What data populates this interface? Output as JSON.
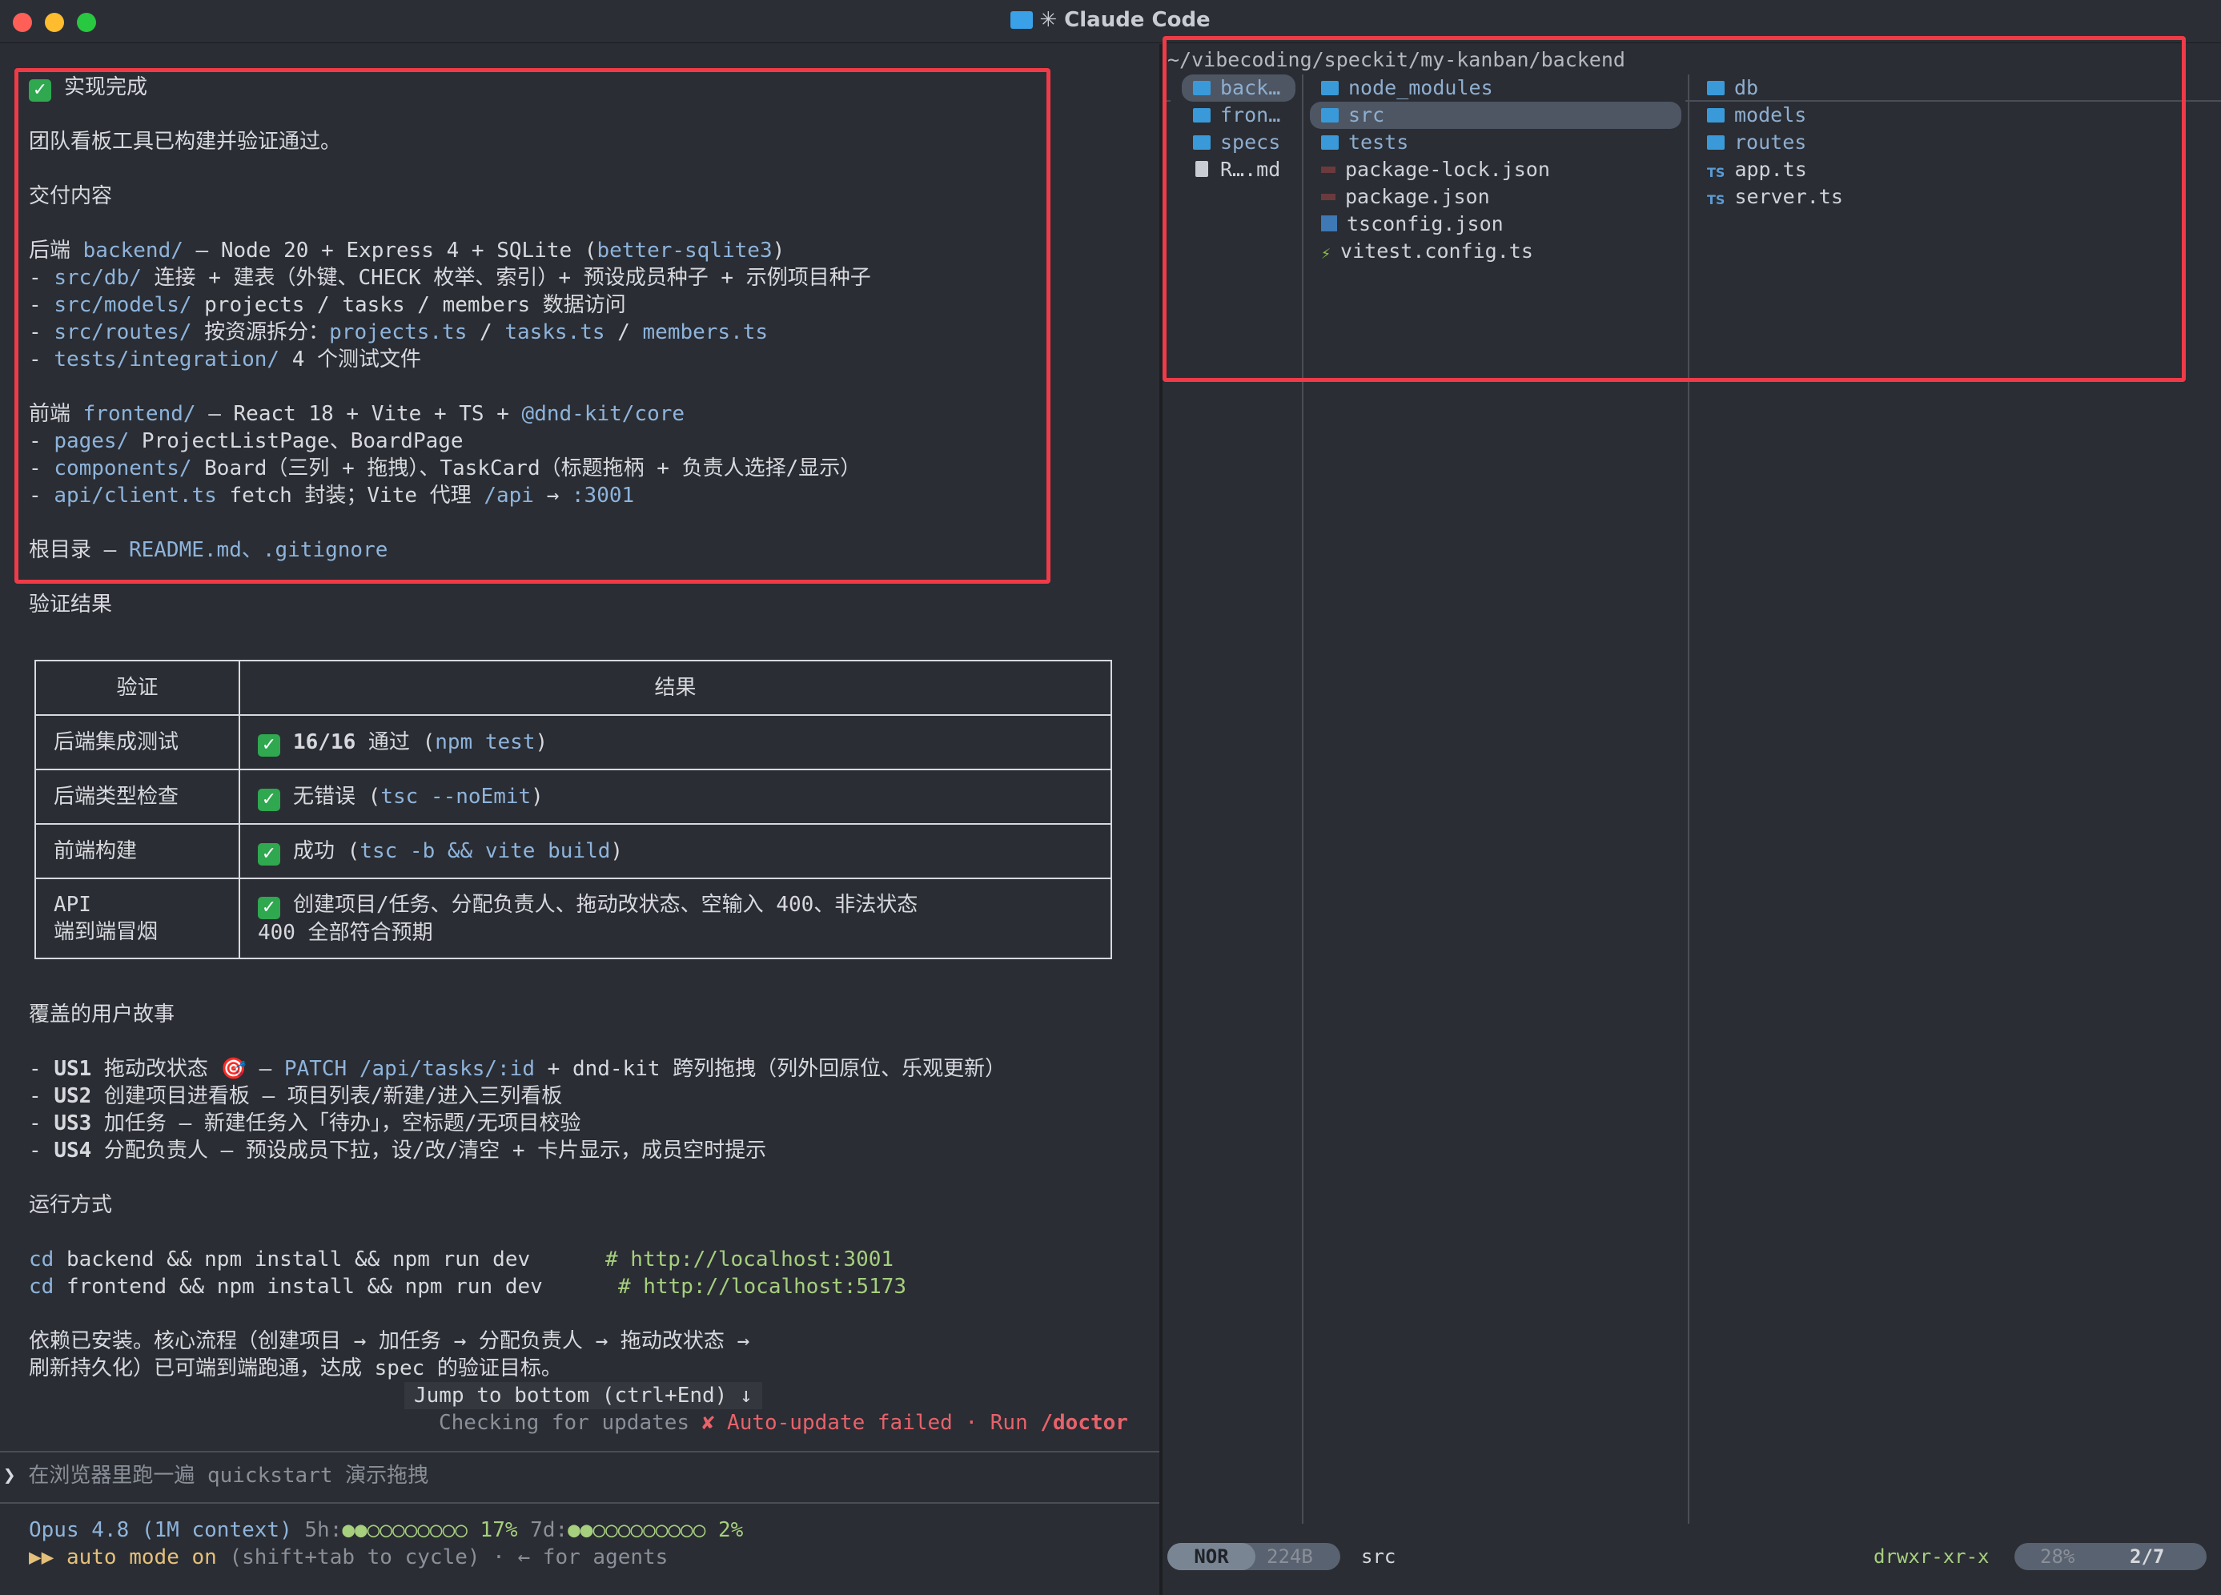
{
  "window": {
    "title": "✳ Claude Code"
  },
  "summary": {
    "heading": "实现完成",
    "intro": "团队看板工具已构建并验证通过。",
    "deliverables_title": "交付内容",
    "backend_label": "后端 ",
    "backend_path": "backend/",
    "backend_desc": " — Node 20 + Express 4 + SQLite (",
    "backend_lib": "better-sqlite3",
    "backend_close": ")",
    "backend_items": [
      {
        "path": "src/db/",
        "text": " 连接 + 建表（外键、CHECK 枚举、索引）+ 预设成员种子 + 示例项目种子"
      },
      {
        "path": "src/models/",
        "text": " projects / tasks / members 数据访问"
      },
      {
        "path": "src/routes/",
        "text": " 按资源拆分：",
        "files": [
          "projects.ts",
          "tasks.ts",
          "members.ts"
        ]
      },
      {
        "path": "tests/integration/",
        "text": " 4 个测试文件"
      }
    ],
    "frontend_label": "前端 ",
    "frontend_path": "frontend/",
    "frontend_desc": " — React 18 + Vite + TS + ",
    "frontend_lib": "@dnd-kit/core",
    "frontend_items": [
      {
        "path": "pages/",
        "text": " ProjectListPage、BoardPage"
      },
      {
        "path": "components/",
        "text": " Board（三列 + 拖拽）、TaskCard（标题拖柄 + 负责人选择/显示）"
      },
      {
        "path": "api/client.ts",
        "text": " fetch 封装；Vite 代理 ",
        "extra1": "/api",
        "arrow": " → ",
        "extra2": ":3001"
      }
    ],
    "root_label": "根目录 — ",
    "root_files": "README.md、.gitignore"
  },
  "verification": {
    "title": "验证结果",
    "col_check": "验证",
    "col_result": "结果",
    "rows": [
      {
        "name": "后端集成测试",
        "result": "16/16 通过 (",
        "cmd": "npm test",
        "close": ")"
      },
      {
        "name": "后端类型检查",
        "result": "无错误 (",
        "cmd": "tsc --noEmit",
        "close": ")"
      },
      {
        "name": "前端构建",
        "result": "成功 (",
        "cmd": "tsc -b && vite build",
        "close": ")"
      },
      {
        "name1": "API",
        "name2": "端到端冒烟",
        "result1": "创建项目/任务、分配负责人、拖动改状态、空输入 400、非法状态",
        "result2": "400 全部符合预期"
      }
    ]
  },
  "stories": {
    "title": "覆盖的用户故事",
    "items": [
      {
        "id": "US1",
        "text": " 拖动改状态 🎯 — ",
        "path": "PATCH /api/tasks/:id",
        "rest": " + dnd-kit 跨列拖拽（列外回原位、乐观更新）"
      },
      {
        "id": "US2",
        "text": " 创建项目进看板 — 项目列表/新建/进入三列看板"
      },
      {
        "id": "US3",
        "text": " 加任务 — 新建任务入「待办」，空标题/无项目校验"
      },
      {
        "id": "US4",
        "text": " 分配负责人 — 预设成员下拉，设/改/清空 + 卡片显示，成员空时提示"
      }
    ]
  },
  "run": {
    "title": "运行方式",
    "cmd1": "backend && npm install && npm run dev",
    "cmd2": "frontend && npm install && npm run dev",
    "cd": "cd",
    "url1": "# http://localhost:3001",
    "url2": "# http://localhost:5173"
  },
  "closing": {
    "line1": "依赖已安装。核心流程（创建项目 → 加任务 → 分配负责人 → 拖动改状态 →",
    "line2": "刷新持久化）已可端到端跑通，达成 spec 的验证目标。"
  },
  "jump": "Jump to bottom (ctrl+End) ↓",
  "update": {
    "checking": "Checking for updates ",
    "failed": "✘ Auto-update failed · Run ",
    "doctor": "/doctor"
  },
  "prompt": {
    "symbol": "❯",
    "text": "在浏览器里跑一遍 quickstart 演示拖拽"
  },
  "statusline": {
    "model": "Opus 4.8 (1M context)",
    "h5_label": " 5h:",
    "h5_dots": "●●○○○○○○○○",
    "h5_pct": " 17%",
    "d7_label": " 7d:",
    "d7_dots": "●●○○○○○○○○○",
    "d7_pct": " 2%",
    "mode_arrows": "▶▶",
    "mode": " auto mode on",
    "mode_hint": " (shift+tab to cycle) · ← for agents"
  },
  "files": {
    "path": "~/vibecoding/speckit/my-kanban/backend",
    "col1": [
      {
        "name": "back…",
        "type": "dir",
        "selected": true
      },
      {
        "name": "fron…",
        "type": "dir"
      },
      {
        "name": "specs",
        "type": "dir"
      },
      {
        "name": "R….md",
        "type": "file"
      }
    ],
    "col2": [
      {
        "name": "node_modules",
        "type": "dir"
      },
      {
        "name": "src",
        "type": "dir",
        "selected": true
      },
      {
        "name": "tests",
        "type": "dir"
      },
      {
        "name": "package-lock.json",
        "type": "pkg"
      },
      {
        "name": "package.json",
        "type": "pkg"
      },
      {
        "name": "tsconfig.json",
        "type": "tsconf"
      },
      {
        "name": "vitest.config.ts",
        "type": "vite"
      }
    ],
    "col3": [
      {
        "name": "db",
        "type": "dir"
      },
      {
        "name": "models",
        "type": "dir"
      },
      {
        "name": "routes",
        "type": "dir"
      },
      {
        "name": "app.ts",
        "type": "ts"
      },
      {
        "name": "server.ts",
        "type": "ts"
      }
    ]
  },
  "fm_status": {
    "mode": "NOR",
    "size": "224B",
    "current": "src",
    "perms": "drwxr-xr-x",
    "percent": "28%",
    "position": "2/7"
  },
  "icons": {
    "ts": "TS",
    "vite": "⚡"
  }
}
